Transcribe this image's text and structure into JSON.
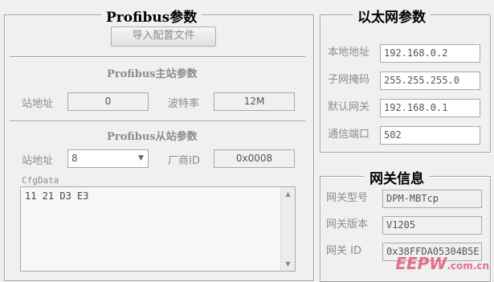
{
  "profibus": {
    "title": "Profibus参数",
    "import_button": "导入配置文件",
    "master_title": "Profibus主站参数",
    "station_label": "站地址",
    "station_value": "0",
    "baud_label": "波特率",
    "baud_value": "12M",
    "slave_title": "Profibus从站参数",
    "slave_station_label": "站地址",
    "slave_station_value": "8",
    "vendor_label": "厂商ID",
    "vendor_value": "0x0008",
    "cfgdata_label": "CfgData",
    "cfgdata_value": "11 21 D3 E3"
  },
  "ethernet": {
    "title": "以太网参数",
    "local_ip_label": "本地地址",
    "local_ip_value": "192.168.0.2",
    "mask_label": "子网掩码",
    "mask_value": "255.255.255.0",
    "gateway_label": "默认网关",
    "gateway_value": "192.168.0.1",
    "port_label": "通信端口",
    "port_value": "502"
  },
  "gateway_info": {
    "title": "网关信息",
    "model_label": "网关型号",
    "model_value": "DPM-MBTcp",
    "version_label": "网关版本",
    "version_value": "V1205",
    "id_label": "网关 ID",
    "id_value": "0x38FFDA05304B5E"
  },
  "watermark": {
    "logo": "EEPW",
    "domain": ".com.cn"
  },
  "icons": {
    "dropdown": "chevron-down-icon",
    "scroll_up": "scroll-up-icon",
    "scroll_down": "scroll-down-icon"
  }
}
